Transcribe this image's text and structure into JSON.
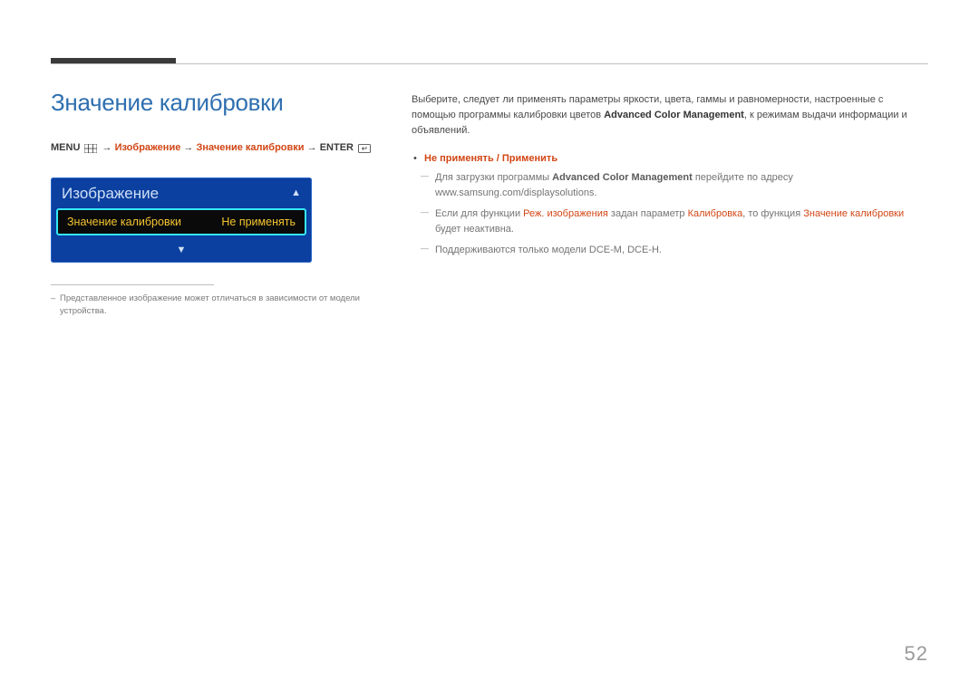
{
  "title": "Значение калибровки",
  "breadcrumb": {
    "menu": "MENU",
    "arrow": " → ",
    "p1": "Изображение",
    "p2": "Значение калибровки",
    "enter": "ENTER"
  },
  "osd": {
    "header": "Изображение",
    "row_label": "Значение калибровки",
    "row_value": "Не применять"
  },
  "left_note": "Представленное изображение может отличаться в зависимости от модели устройства.",
  "right": {
    "para_pre": "Выберите, следует ли применять параметры яркости, цвета, гаммы и равномерности, настроенные с помощью программы калибровки цветов ",
    "para_bold": "Advanced Color Management",
    "para_post": ", к режимам выдачи информации и объявлений.",
    "bullet1": "Не применять / Применить",
    "dash1_pre": "Для загрузки программы ",
    "dash1_bold": "Advanced Color Management",
    "dash1_mid": " перейдите по адресу ",
    "dash1_url": "www.samsung.com/displaysolutions.",
    "dash2_pre": "Если для функции ",
    "dash2_h1": "Реж. изображения",
    "dash2_mid1": " задан параметр ",
    "dash2_h2": "Калибровка",
    "dash2_mid2": ", то функция ",
    "dash2_h3": "Значение калибровки",
    "dash2_post": " будет неактивна.",
    "dash3": "Поддерживаются только модели DCE-M, DCE-H."
  },
  "page": "52"
}
